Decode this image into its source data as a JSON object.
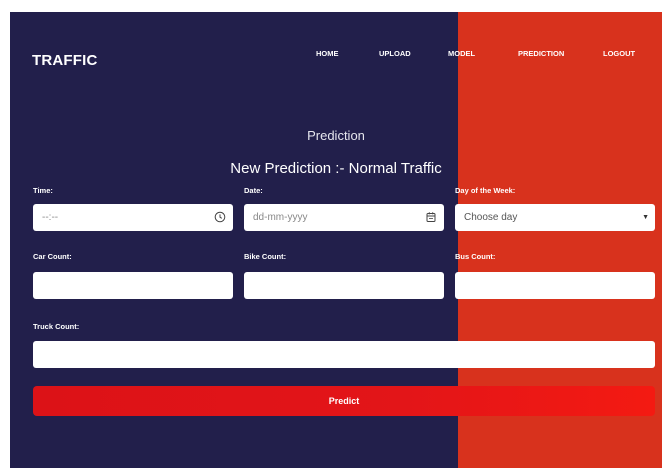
{
  "brand": "TRAFFIC",
  "nav": {
    "items": [
      "HOME",
      "UPLOAD",
      "MODEL",
      "PREDICTION",
      "LOGOUT"
    ]
  },
  "page": {
    "subtitle": "Prediction",
    "heading": "New Prediction :- Normal Traffic"
  },
  "form": {
    "time_label": "Time:",
    "time_placeholder": "--:--",
    "date_label": "Date:",
    "date_placeholder": "dd-mm-yyyy",
    "day_label": "Day of the Week:",
    "day_selected": "Choose day",
    "car_label": "Car Count:",
    "car_value": "",
    "bike_label": "Bike Count:",
    "bike_value": "",
    "bus_label": "Bus Count:",
    "bus_value": "",
    "truck_label": "Truck Count:",
    "truck_value": "",
    "submit_label": "Predict"
  },
  "colors": {
    "navy": "#221f4b",
    "accent_red": "#d8321d",
    "button_red": "#e31518"
  }
}
